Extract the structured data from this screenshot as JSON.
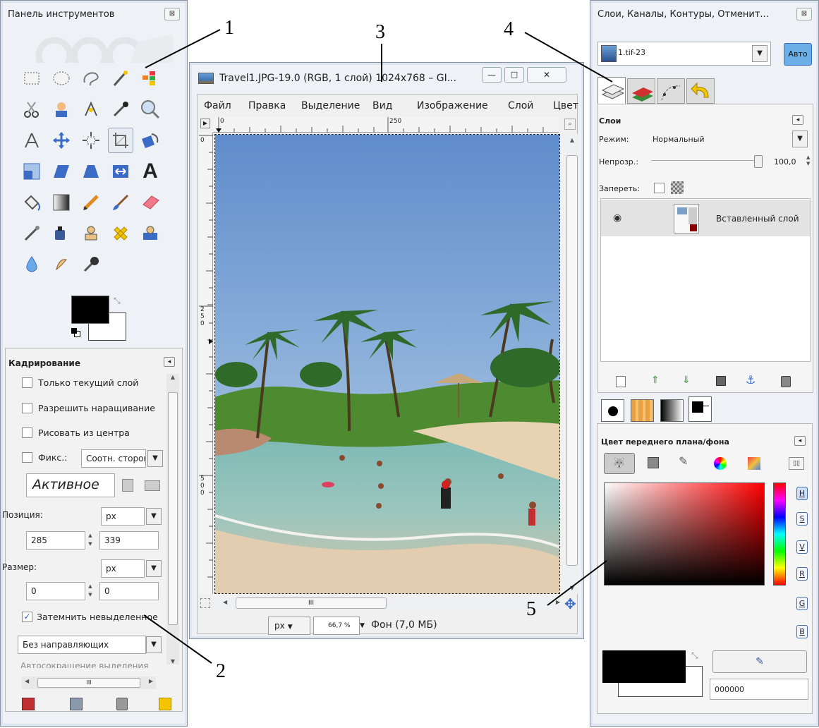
{
  "callouts": [
    "1",
    "2",
    "3",
    "4",
    "5"
  ],
  "toolbox": {
    "title": "Панель инструментов",
    "close_glyph": "⊠",
    "tool_options_title": "Кадрирование",
    "options": {
      "current_layer_only": "Только текущий слой",
      "allow_growing": "Разрешить наращивание",
      "expand_from_center": "Рисовать из центра",
      "fixed_label": "Фикс.:",
      "fixed_value": "Соотн. сторон",
      "active_value": "Активное",
      "position_label": "Позиция:",
      "position_unit": "px",
      "position_x": "285",
      "position_y": "339",
      "size_label": "Размер:",
      "size_unit": "px",
      "size_w": "0",
      "size_h": "0",
      "highlight_label": "Затемнить невыделенное",
      "highlight_checked": true,
      "guides_value": "Без направляющих",
      "autoshrink_label": "Автосокращение выделения",
      "hscroll_glyph": "III"
    },
    "tools": [
      "rect-select",
      "ellipse-select",
      "free-select",
      "fuzzy-select",
      "by-color-select",
      "scissors-select",
      "foreground-select",
      "paths",
      "color-picker",
      "zoom",
      "measure",
      "move",
      "align",
      "crop",
      "rotate",
      "scale",
      "shear",
      "perspective",
      "flip",
      "text",
      "bucket-fill",
      "blend",
      "pencil",
      "paintbrush",
      "eraser",
      "airbrush",
      "ink",
      "clone",
      "heal",
      "perspective-clone",
      "blur",
      "smudge",
      "dodge-burn"
    ],
    "colors": {
      "fg": "#000000",
      "bg": "#ffffff"
    }
  },
  "image_window": {
    "title": "Travel1.JPG-19.0 (RGB, 1 слой) 1024x768 – GI...",
    "menu": [
      "Файл",
      "Правка",
      "Выделение",
      "Вид",
      "Изображение",
      "Слой",
      "Цвет"
    ],
    "ruler_top_label": "250",
    "ruler_left_labels": [
      "0",
      "250",
      "500"
    ],
    "ruler_top_zero": "0",
    "unit": "px",
    "zoom": "66,7 %",
    "status": "Фон (7,0 МБ)",
    "hscroll_glyph": "III"
  },
  "dock": {
    "title": "Слои, Каналы, Контуры, Отменит...",
    "image_selector": "1.tif-23",
    "auto_button": "Авто",
    "layers": {
      "title": "Слои",
      "mode_label": "Режим:",
      "mode_value": "Нормальный",
      "opacity_label": "Непрозр.:",
      "opacity_value": "100,0",
      "opacity_level": 1.0,
      "lock_label": "Запереть:",
      "layer_name": "Вставленный слой"
    },
    "fgbg": {
      "title": "Цвет переднего плана/фона",
      "channels": [
        "H",
        "S",
        "V",
        "R",
        "G",
        "B"
      ],
      "hex_value": "000000"
    }
  }
}
